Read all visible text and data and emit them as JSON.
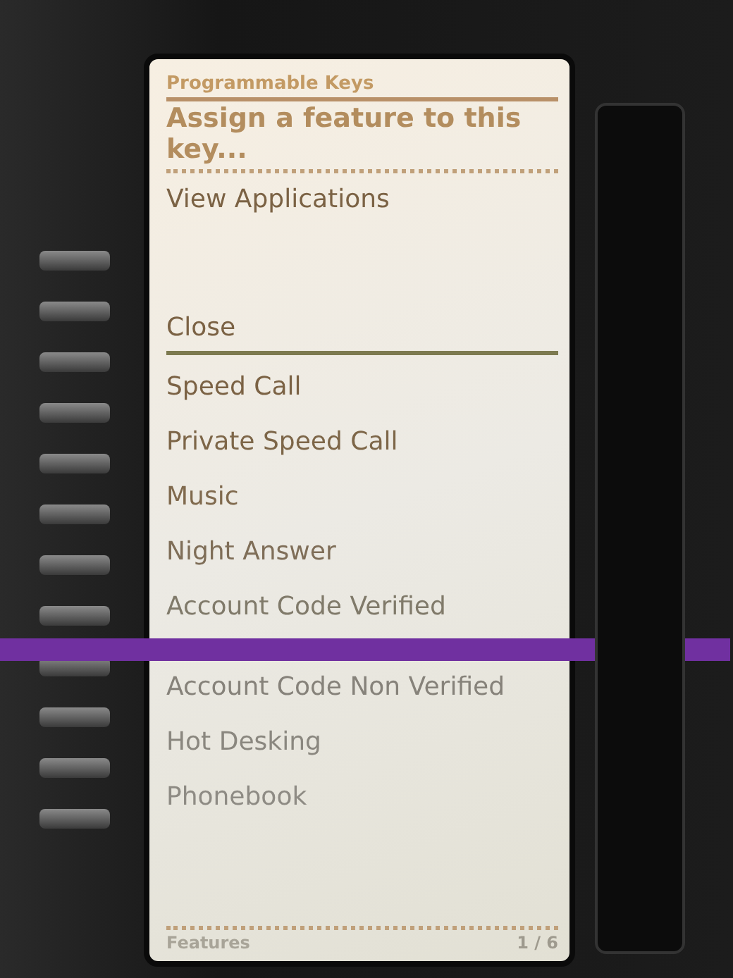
{
  "screen": {
    "title": "Programmable Keys",
    "prompt": "Assign a feature to this key...",
    "actions": [
      "View Applications",
      "Close"
    ],
    "features": [
      "Speed Call",
      "Private Speed Call",
      "Music",
      "Night Answer",
      "Account Code Verified",
      "Account Code Non Verified",
      "Hot Desking",
      "Phonebook"
    ],
    "footer": {
      "label": "Features",
      "page": "1 / 6"
    }
  }
}
